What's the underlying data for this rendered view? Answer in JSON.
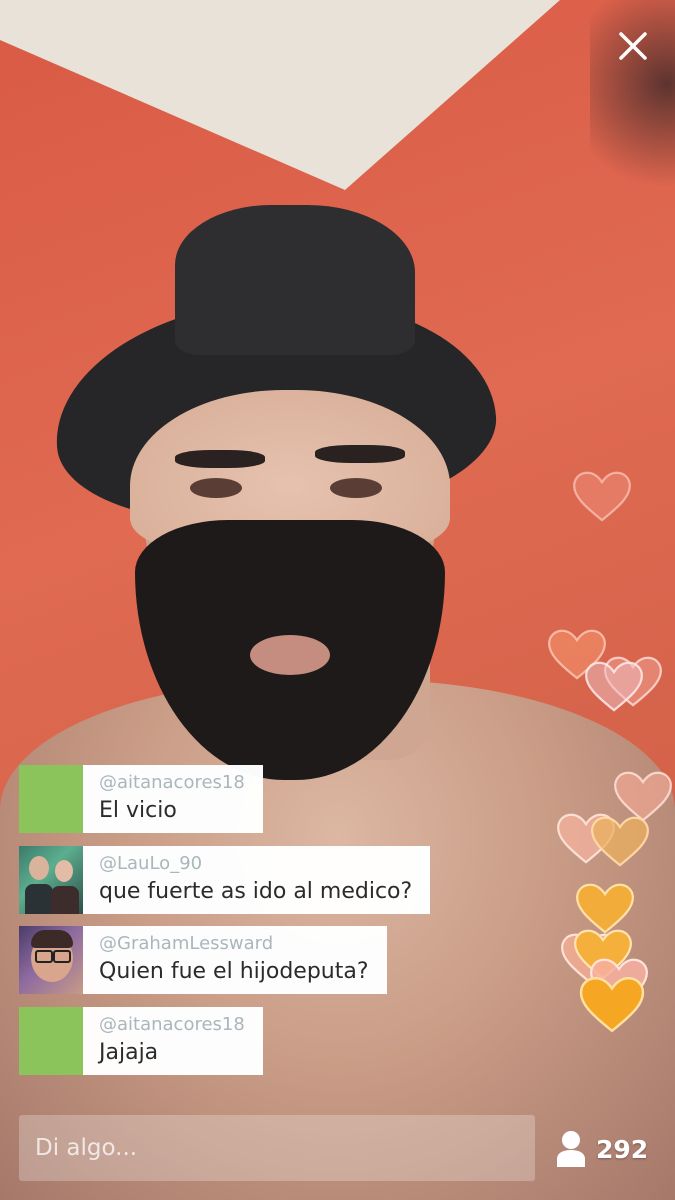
{
  "close_icon": "close-icon",
  "comments": [
    {
      "username": "@aitanacores18",
      "message": "El vicio",
      "avatar": "green-placeholder"
    },
    {
      "username": "@LauLo_90",
      "message": "que fuerte as ido al medico?",
      "avatar": "photo"
    },
    {
      "username": "@GrahamLessward",
      "message": "Quien fue el hijodeputa?",
      "avatar": "photo"
    },
    {
      "username": "@aitanacores18",
      "message": "Jajaja",
      "avatar": "green-placeholder"
    }
  ],
  "comment_input": {
    "placeholder": "Di algo..."
  },
  "viewers": {
    "icon": "person-icon",
    "count": "292"
  },
  "colors": {
    "placeholder_avatar": "#8ac45a",
    "username_text": "#a9b7ba",
    "heart_orange": "#f5a623",
    "heart_pink": "#f7b3a6"
  }
}
